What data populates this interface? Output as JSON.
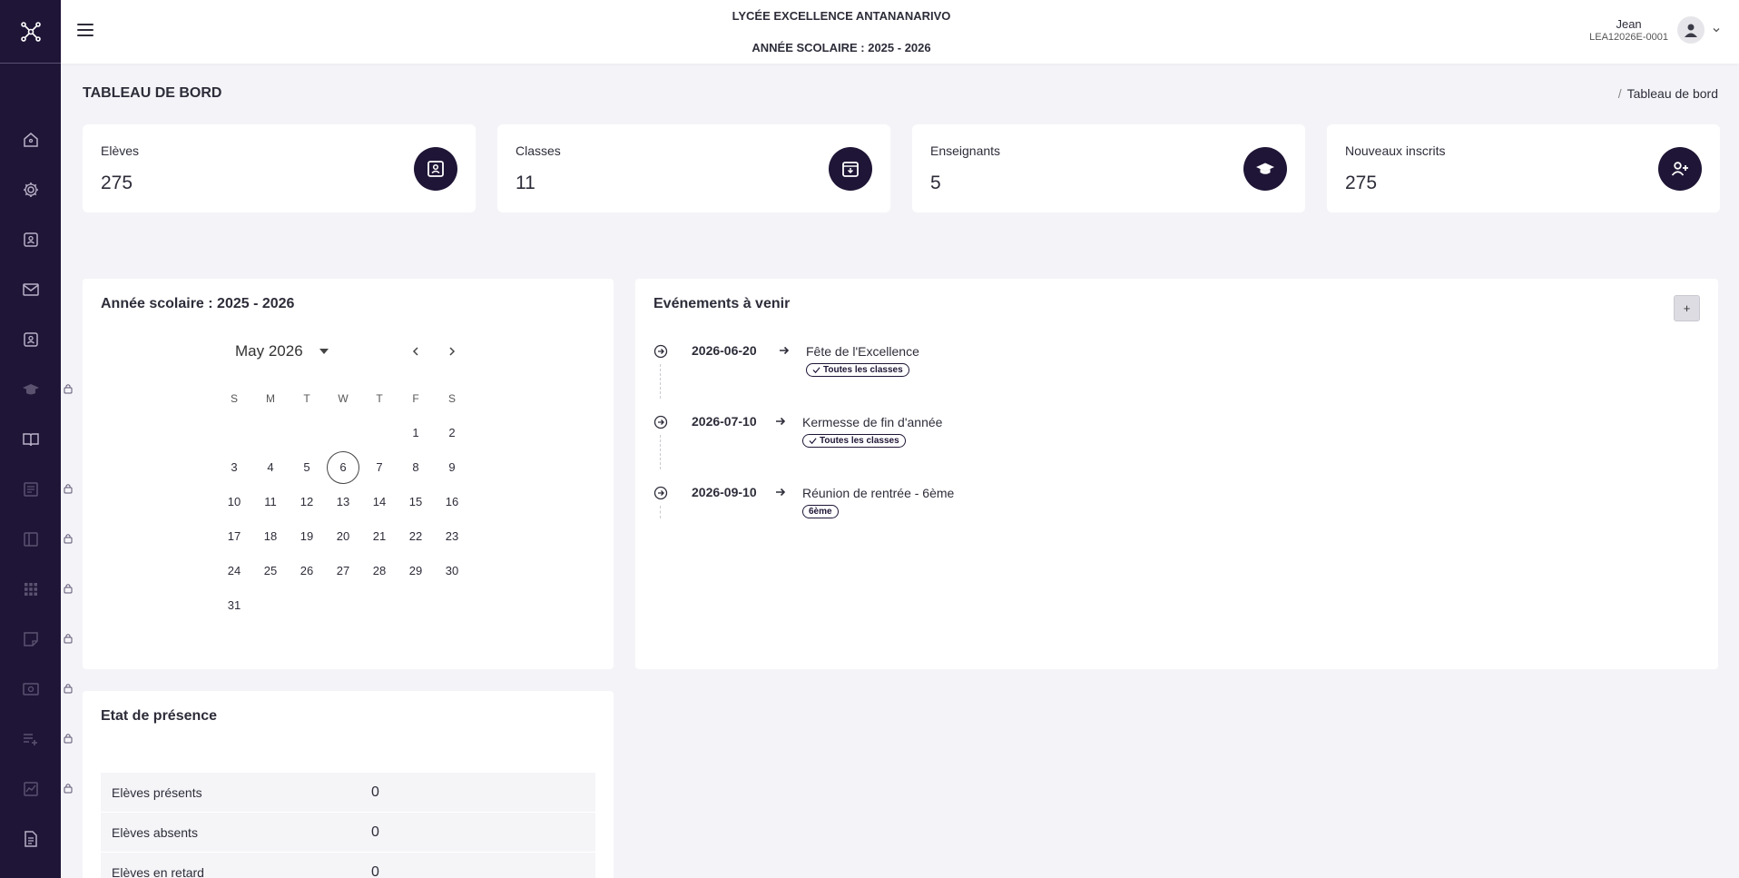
{
  "header": {
    "school_name": "LYCÉE EXCELLENCE ANTANANARIVO",
    "school_year": "ANNÉE SCOLAIRE : 2025 - 2026",
    "user_name": "Jean",
    "user_id": "LEA12026E-0001"
  },
  "page": {
    "title": "TABLEAU DE BORD",
    "breadcrumb_sep": "/",
    "breadcrumb_current": "Tableau de bord"
  },
  "sidebar": {
    "items": [
      {
        "icon": "home-icon",
        "locked": false
      },
      {
        "icon": "gear-icon",
        "locked": false
      },
      {
        "icon": "student-badge-icon",
        "locked": false
      },
      {
        "icon": "mail-icon",
        "locked": false
      },
      {
        "icon": "teacher-badge-icon",
        "locked": false
      },
      {
        "icon": "graduation-cap-icon",
        "locked": true
      },
      {
        "icon": "book-icon",
        "locked": false
      },
      {
        "icon": "document-icon",
        "locked": true
      },
      {
        "icon": "panel-icon",
        "locked": true
      },
      {
        "icon": "grid-icon",
        "locked": true
      },
      {
        "icon": "note-icon",
        "locked": true
      },
      {
        "icon": "money-icon",
        "locked": true
      },
      {
        "icon": "list-add-icon",
        "locked": true
      },
      {
        "icon": "chart-icon",
        "locked": true
      },
      {
        "icon": "report-icon",
        "locked": false
      }
    ]
  },
  "stats": [
    {
      "label": "Elèves",
      "value": "275",
      "icon": "student-card-icon"
    },
    {
      "label": "Classes",
      "value": "11",
      "icon": "archive-box-icon"
    },
    {
      "label": "Enseignants",
      "value": "5",
      "icon": "graduation-cap-icon"
    },
    {
      "label": "Nouveaux inscrits",
      "value": "275",
      "icon": "user-add-icon"
    }
  ],
  "calendar": {
    "panel_title": "Année scolaire : 2025 - 2026",
    "month_label": "May 2026",
    "weekdays": [
      "S",
      "M",
      "T",
      "W",
      "T",
      "F",
      "S"
    ],
    "weeks": [
      [
        "",
        "",
        "",
        "",
        "",
        "1",
        "2"
      ],
      [
        "3",
        "4",
        "5",
        "6",
        "7",
        "8",
        "9"
      ],
      [
        "10",
        "11",
        "12",
        "13",
        "14",
        "15",
        "16"
      ],
      [
        "17",
        "18",
        "19",
        "20",
        "21",
        "22",
        "23"
      ],
      [
        "24",
        "25",
        "26",
        "27",
        "28",
        "29",
        "30"
      ],
      [
        "31",
        "",
        "",
        "",
        "",
        "",
        ""
      ]
    ],
    "today": "6"
  },
  "events": {
    "panel_title": "Evénements à venir",
    "add_label": "+",
    "items": [
      {
        "date": "2026-06-20",
        "title": "Fête de l'Excellence",
        "badge": "Toutes les classes",
        "badge_check": true
      },
      {
        "date": "2026-07-10",
        "title": "Kermesse de fin d'année",
        "badge": "Toutes les classes",
        "badge_check": true
      },
      {
        "date": "2026-09-10",
        "title": "Réunion de rentrée - 6ème",
        "badge": "6ème",
        "badge_check": false
      }
    ]
  },
  "attendance": {
    "panel_title": "Etat de présence",
    "rows": [
      {
        "label": "Elèves présents",
        "value": "0"
      },
      {
        "label": "Elèves absents",
        "value": "0"
      },
      {
        "label": "Elèves en retard",
        "value": "0"
      }
    ]
  },
  "colors": {
    "sidebar_bg": "#1f1536",
    "page_bg": "#f4f4f8",
    "icon_bg": "#1f1536"
  }
}
